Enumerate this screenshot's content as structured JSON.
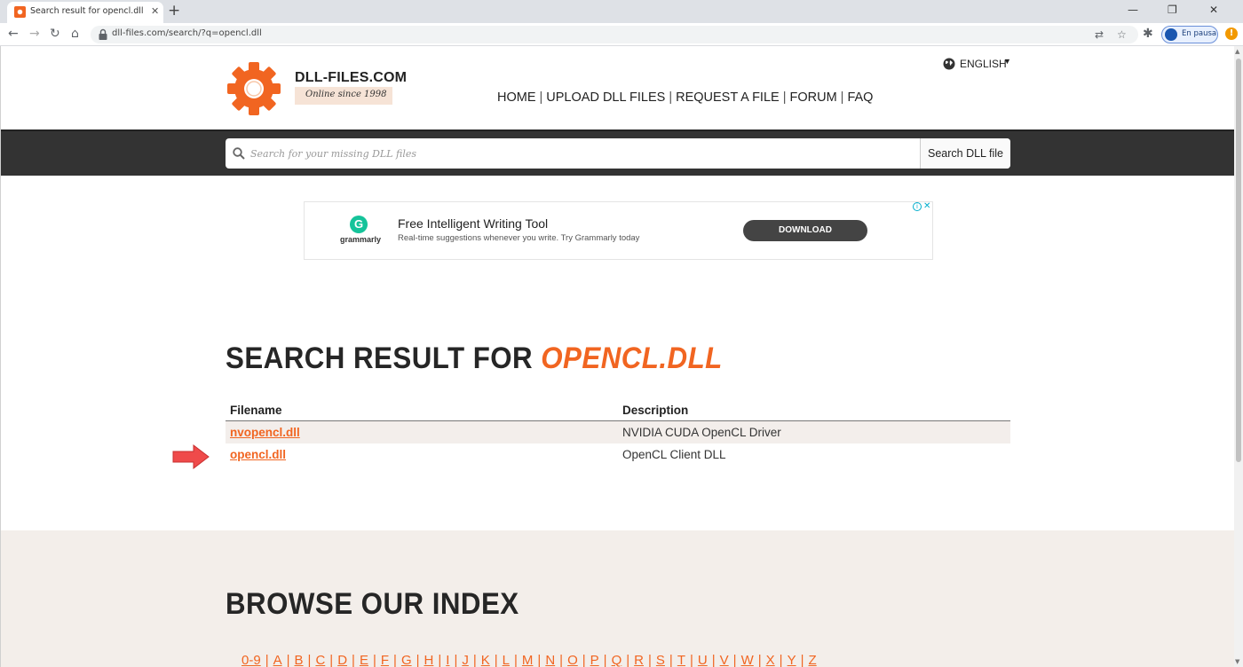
{
  "browser": {
    "tab_title": "Search result for opencl.dll | DLL-files.com",
    "url": "dll-files.com/search/?q=opencl.dll",
    "profile_label": "En pausa",
    "update_badge": "!"
  },
  "header": {
    "brand": "DLL-FILES.COM",
    "tagline": "Online since 1998",
    "language": "ENGLISH",
    "nav": [
      {
        "label": "HOME"
      },
      {
        "label": "UPLOAD DLL FILES"
      },
      {
        "label": "REQUEST A FILE"
      },
      {
        "label": "FORUM"
      },
      {
        "label": "FAQ"
      }
    ]
  },
  "search": {
    "placeholder": "Search for your missing DLL files",
    "button_label": "Search DLL file"
  },
  "ad": {
    "brand": "grammarly",
    "logo_letter": "G",
    "title": "Free Intelligent Writing Tool",
    "subtitle": "Real-time suggestions whenever you write. Try Grammarly today",
    "cta": "DOWNLOAD"
  },
  "results": {
    "heading_prefix": "SEARCH RESULT FOR ",
    "query": "OPENCL.DLL",
    "columns": {
      "filename": "Filename",
      "description": "Description"
    },
    "rows": [
      {
        "filename": "nvopencl.dll",
        "description": "NVIDIA CUDA OpenCL Driver"
      },
      {
        "filename": "opencl.dll",
        "description": "OpenCL Client DLL"
      }
    ]
  },
  "browse": {
    "heading": "BROWSE OUR INDEX",
    "letters": [
      "0-9",
      "A",
      "B",
      "C",
      "D",
      "E",
      "F",
      "G",
      "H",
      "I",
      "J",
      "K",
      "L",
      "M",
      "N",
      "O",
      "P",
      "Q",
      "R",
      "S",
      "T",
      "U",
      "V",
      "W",
      "X",
      "Y",
      "Z"
    ]
  },
  "colors": {
    "accent": "#f16521",
    "search_band": "#333333",
    "browse_bg": "#f3eeea",
    "arrow": "#ef4a4a"
  }
}
